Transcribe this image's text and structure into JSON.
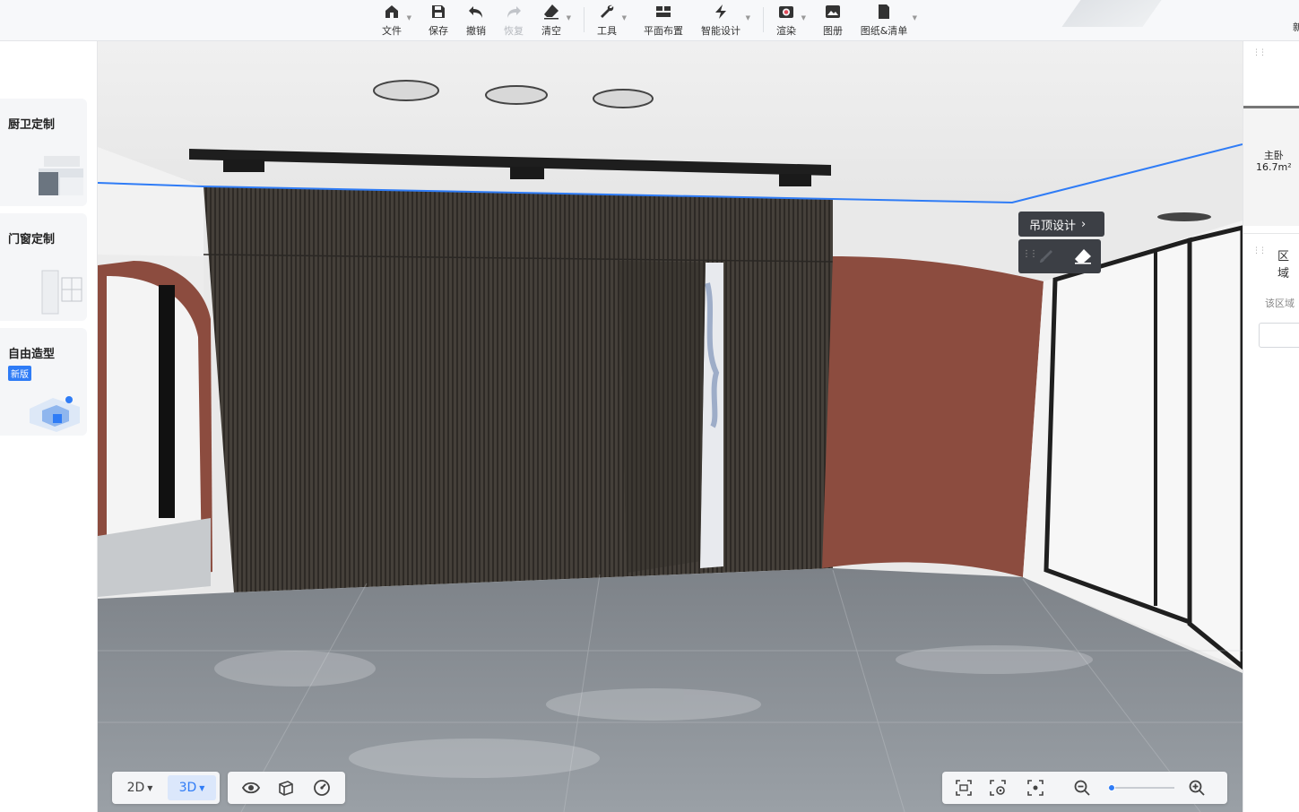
{
  "toolbar": {
    "file": "文件",
    "save": "保存",
    "undo": "撤销",
    "redo": "恢复",
    "clear": "清空",
    "tools": "工具",
    "floor_plan": "平面布置",
    "smart_design": "智能设计",
    "render": "渲染",
    "album": "图册",
    "drawings_list": "图纸&清单",
    "right_truncated": "新"
  },
  "left_panel": {
    "cards": [
      {
        "title": "厨卫定制"
      },
      {
        "title": "门窗定制"
      },
      {
        "title": "自由造型",
        "badge": "新版"
      }
    ]
  },
  "viewport": {
    "ceiling_popup": {
      "title": "吊顶设计"
    },
    "view_switch": {
      "two_d": "2D",
      "three_d": "3D",
      "active": "3D"
    },
    "zoom": {
      "level_fraction": 0.05
    }
  },
  "right_panel": {
    "room_name": "主卧",
    "room_area": "16.7m²",
    "tab": "区域",
    "hint": "该区域",
    "input_value": ""
  },
  "colors": {
    "accent": "#2f7cf6",
    "wall_slat": "#3f3b36",
    "terracotta": "#8c4c3f",
    "popup_bg": "#3c3f45"
  }
}
